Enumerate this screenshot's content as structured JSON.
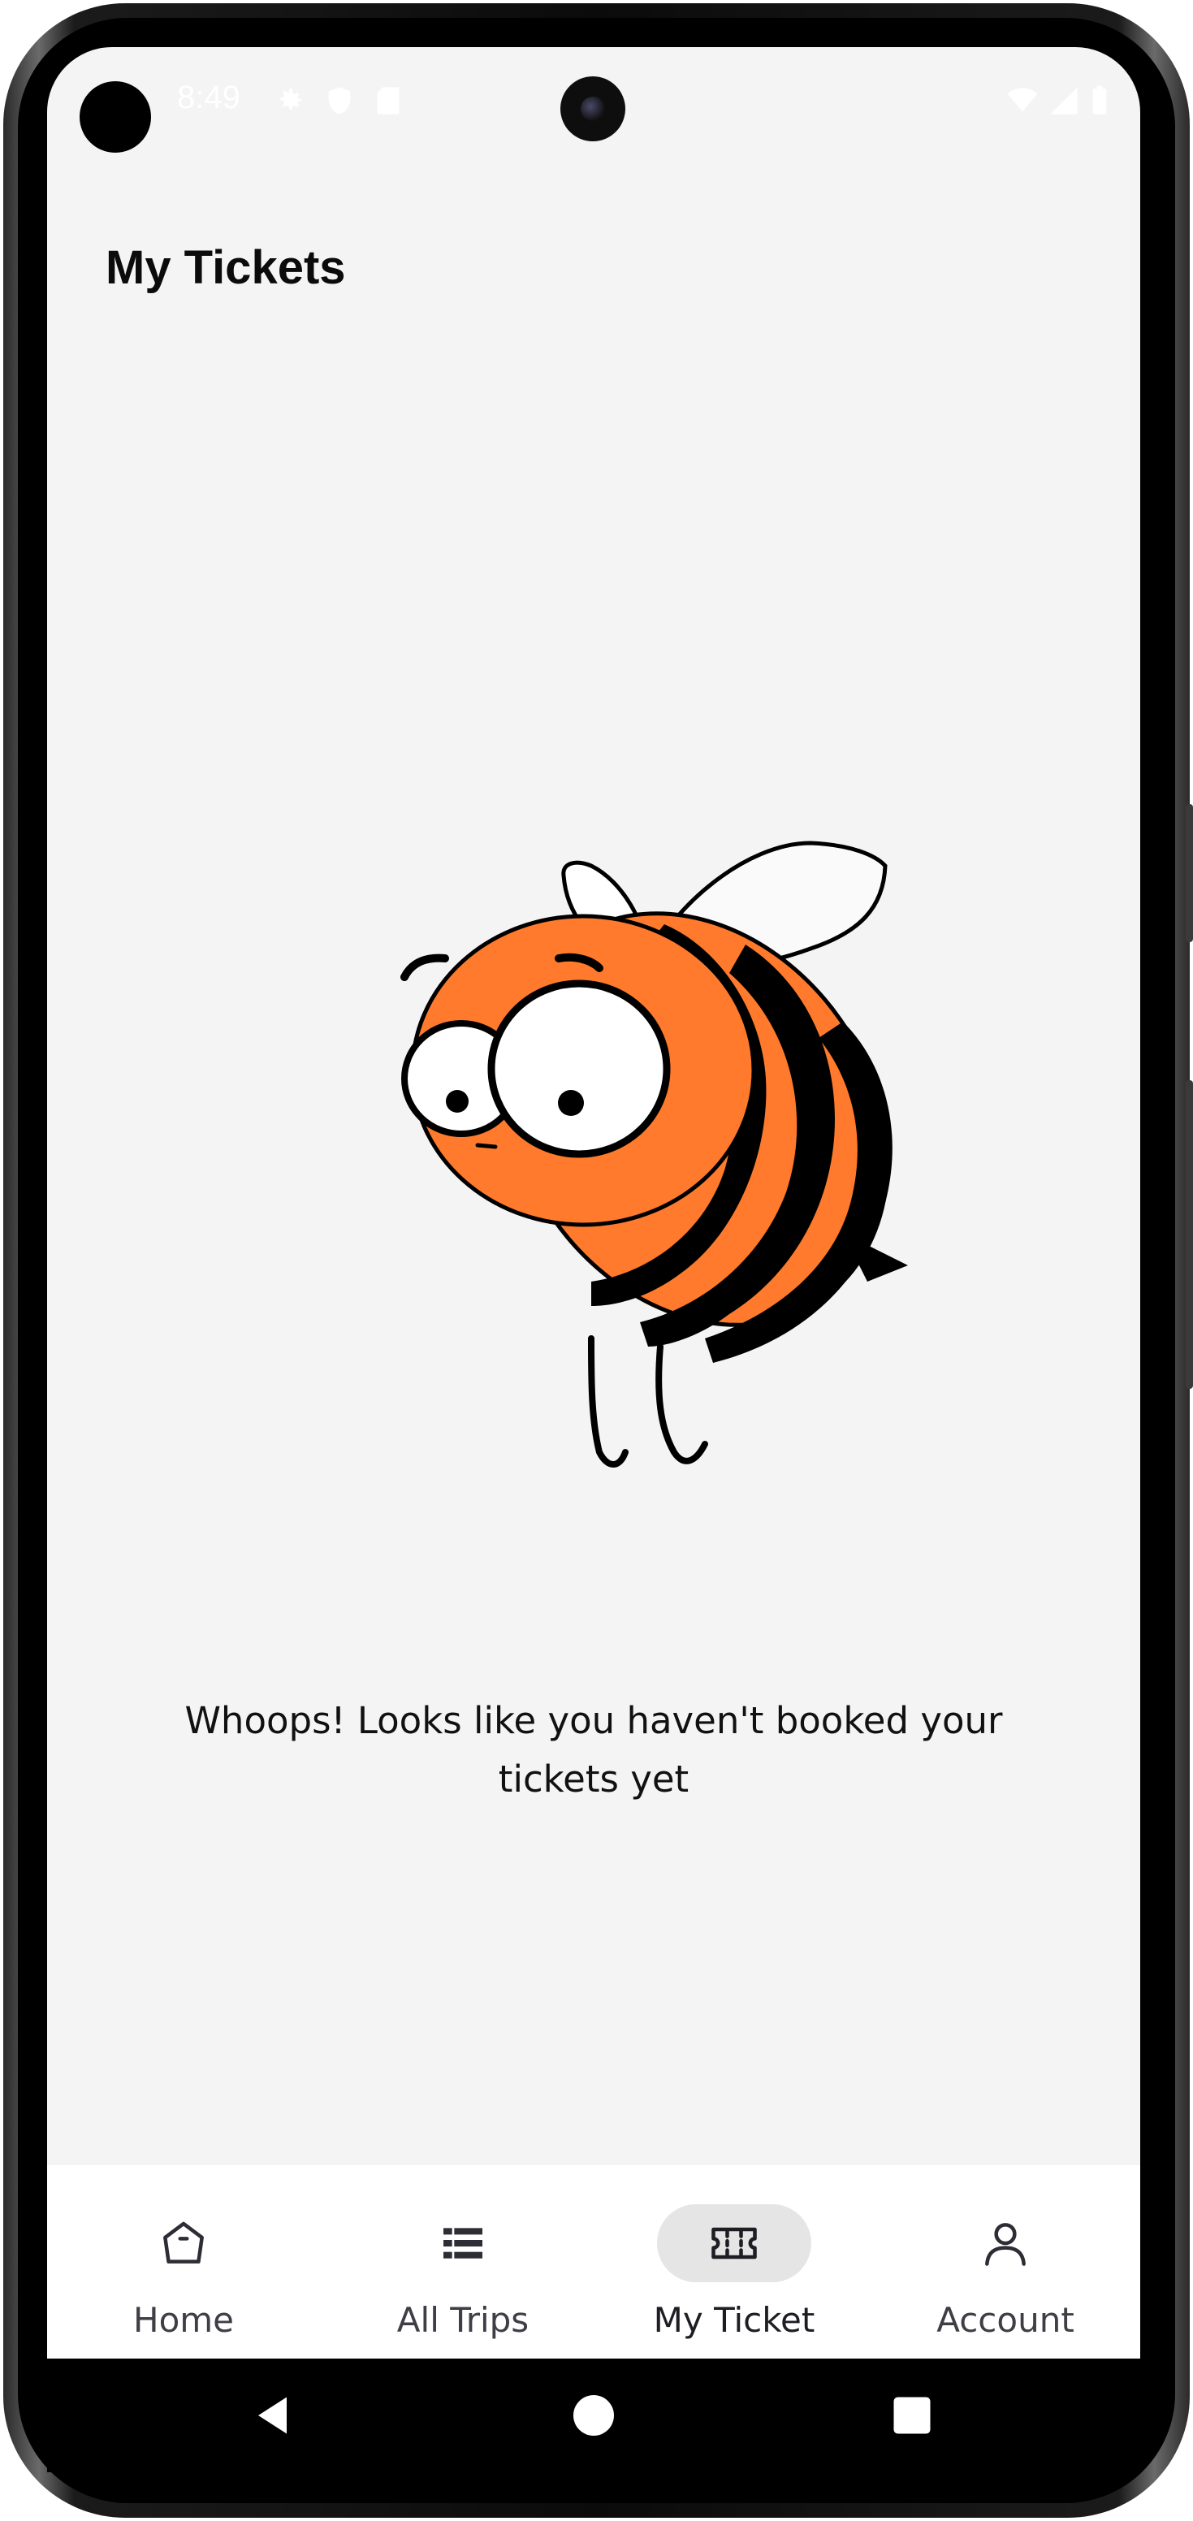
{
  "status_bar": {
    "time": "8:49",
    "icons": [
      "settings-icon",
      "shield-icon",
      "sd-card-icon",
      "wifi-icon",
      "signal-icon",
      "battery-icon"
    ]
  },
  "header": {
    "title": "My Tickets"
  },
  "empty_state": {
    "illustration": "bee-illustration",
    "message": "Whoops! Looks like you haven't booked your tickets yet"
  },
  "bottom_nav": {
    "items": [
      {
        "label": "Home",
        "icon": "home-icon",
        "active": false
      },
      {
        "label": "All Trips",
        "icon": "list-icon",
        "active": false
      },
      {
        "label": "My Ticket",
        "icon": "ticket-icon",
        "active": true
      },
      {
        "label": "Account",
        "icon": "account-icon",
        "active": false
      }
    ]
  },
  "system_nav": {
    "buttons": [
      "back-icon",
      "home-circle-icon",
      "recents-icon"
    ]
  },
  "colors": {
    "background": "#f4f4f4",
    "bee_orange": "#ff7a2c",
    "nav_active_pill": "#e5e5e5",
    "text": "#111111"
  }
}
